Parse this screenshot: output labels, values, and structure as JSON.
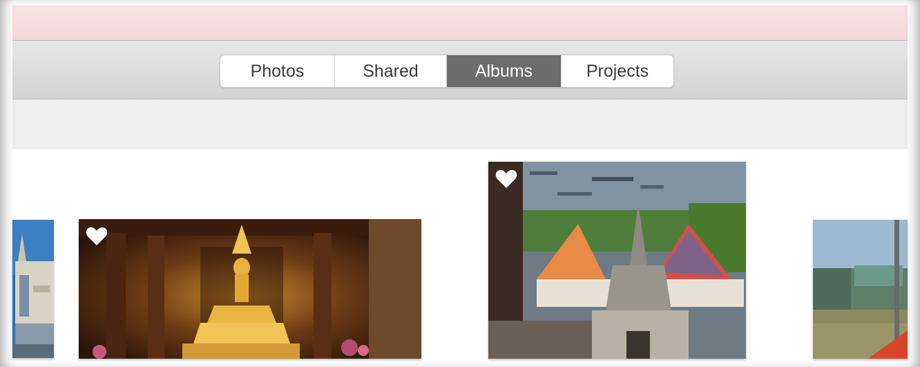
{
  "toolbar": {
    "tabs": [
      {
        "label": "Photos",
        "active": false
      },
      {
        "label": "Shared",
        "active": false
      },
      {
        "label": "Albums",
        "active": true
      },
      {
        "label": "Projects",
        "active": false
      }
    ]
  },
  "photos": [
    {
      "name": "temple-spire",
      "favorite": false
    },
    {
      "name": "golden-buddha",
      "favorite": true
    },
    {
      "name": "temple-river-view",
      "favorite": true
    },
    {
      "name": "river-pier",
      "favorite": false
    }
  ],
  "colors": {
    "titlebar": "#f3d8db",
    "toolbar": "#dcdcdf",
    "active_tab": "#6c6c70",
    "heart": "#ffffff"
  }
}
